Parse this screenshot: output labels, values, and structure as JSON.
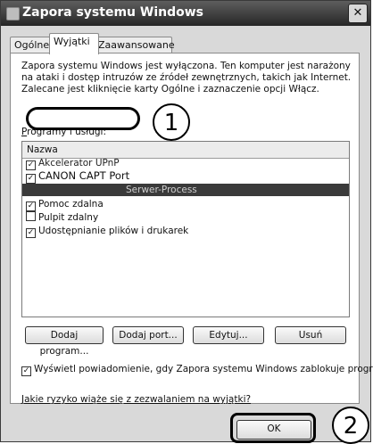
{
  "window": {
    "title": "Zapora systemu Windows",
    "close_glyph": "✕"
  },
  "tabs": [
    {
      "label": "Ogólne"
    },
    {
      "label": "Wyjątki"
    },
    {
      "label": "Zaawansowane"
    }
  ],
  "description": "Zapora systemu Windows jest wyłączona. Ten komputer jest narażony na ataki i dostęp intruzów ze źródeł zewnętrznych, takich jak Internet. Zalecane jest kliknięcie karty Ogólne i zaznaczenie opcji Włącz.",
  "programs": {
    "label_prefix": "P",
    "label_rest": "rogramy i usługi:",
    "column_header": "Nazwa",
    "items": [
      {
        "label": "Akcelerator UPnP",
        "checked": true
      },
      {
        "label": "CANON CAPT Port",
        "checked": true
      },
      {
        "label": "Serwer-Process",
        "checked": true
      },
      {
        "label": "Pomoc zdalna",
        "checked": true
      },
      {
        "label": "Pulpit zdalny",
        "checked": false
      },
      {
        "label": "Udostępnianie plików i drukarek",
        "checked": true
      }
    ]
  },
  "buttons": {
    "add_program": "Dodaj program...",
    "add_port": "Dodaj port...",
    "edit": "Edytuj...",
    "delete": "Usuń",
    "ok": "OK"
  },
  "notify": {
    "label": "Wyświetl powiadomienie, gdy Zapora systemu Windows zablokuje program",
    "checked": true
  },
  "risk_link": "Jakie ryzyko wiąże się z zezwalaniem na wyjątki?",
  "callouts": {
    "one": "1",
    "two": "2"
  },
  "checkmark": "✓"
}
